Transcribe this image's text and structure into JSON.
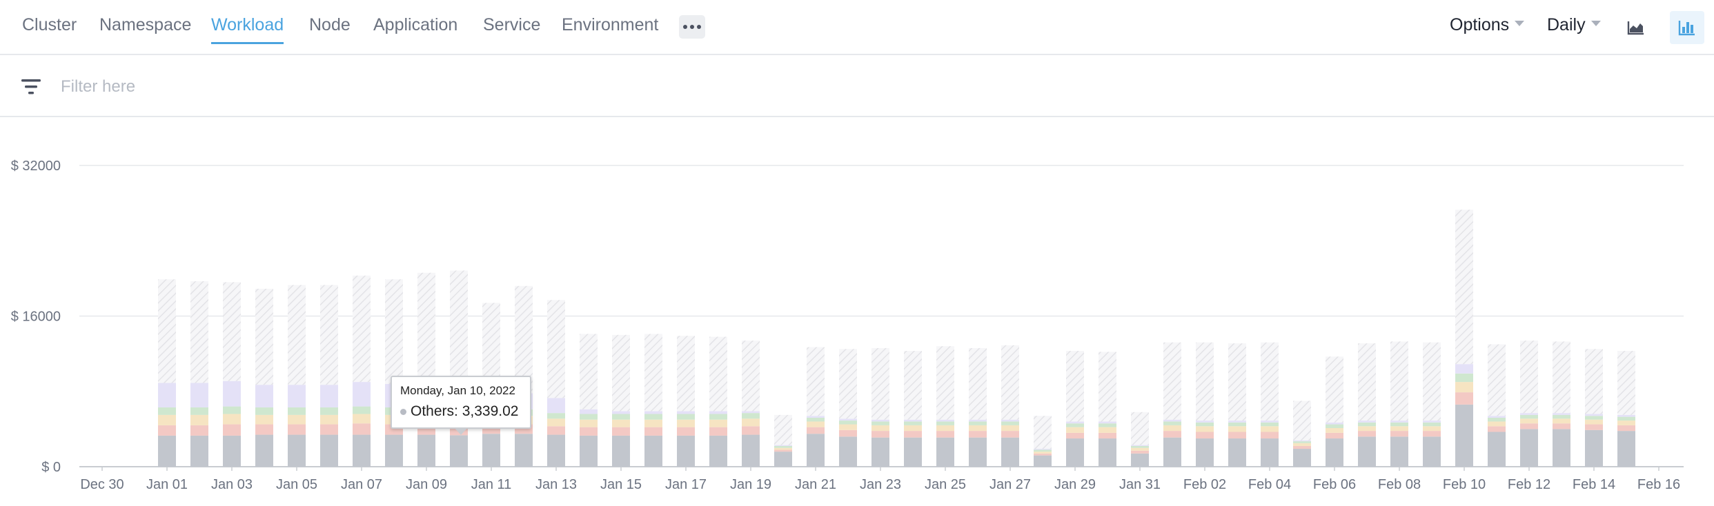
{
  "nav": {
    "tabs": [
      {
        "label": "Cluster"
      },
      {
        "label": "Namespace"
      },
      {
        "label": "Workload",
        "active": true
      },
      {
        "label": "Node"
      },
      {
        "label": "Application"
      },
      {
        "label": "Service"
      },
      {
        "label": "Environment"
      }
    ],
    "more_icon": "more-horizontal-icon",
    "options_label": "Options",
    "interval_label": "Daily",
    "area_chart_icon": "area-chart-icon",
    "bar_chart_icon": "bar-chart-icon"
  },
  "filter": {
    "icon": "filter-icon",
    "placeholder": "Filter here"
  },
  "colors": {
    "accent": "#4aa3df",
    "others_bar": "#c2c6cd",
    "hatch": "#ececef",
    "lavender": "#e4e1f7"
  },
  "tooltip": {
    "title": "Monday, Jan 10, 2022",
    "series": "Others:",
    "value": "3,339.02"
  },
  "chart_data": {
    "type": "bar",
    "stacked": true,
    "title": "",
    "xlabel": "",
    "ylabel": "",
    "ylim": [
      0,
      32000
    ],
    "y_ticks": [
      {
        "value": 0,
        "label": "$ 0"
      },
      {
        "value": 16000,
        "label": "$ 16000"
      },
      {
        "value": 32000,
        "label": "$ 32000"
      }
    ],
    "x_ticks": [
      "Dec 30",
      "Jan 01",
      "Jan 03",
      "Jan 05",
      "Jan 07",
      "Jan 09",
      "Jan 11",
      "Jan 13",
      "Jan 15",
      "Jan 17",
      "Jan 19",
      "Jan 21",
      "Jan 23",
      "Jan 25",
      "Jan 27",
      "Jan 29",
      "Jan 31",
      "Feb 02",
      "Feb 04",
      "Feb 06",
      "Feb 08",
      "Feb 10",
      "Feb 12",
      "Feb 14",
      "Feb 16"
    ],
    "grid": true,
    "categories": [
      "Jan 01",
      "Jan 02",
      "Jan 03",
      "Jan 04",
      "Jan 05",
      "Jan 06",
      "Jan 07",
      "Jan 08",
      "Jan 09",
      "Jan 10",
      "Jan 11",
      "Jan 12",
      "Jan 13",
      "Jan 14",
      "Jan 15",
      "Jan 16",
      "Jan 17",
      "Jan 18",
      "Jan 19",
      "Jan 20",
      "Jan 21",
      "Jan 22",
      "Jan 23",
      "Jan 24",
      "Jan 25",
      "Jan 26",
      "Jan 27",
      "Jan 28",
      "Jan 29",
      "Jan 30",
      "Jan 31",
      "Feb 01",
      "Feb 02",
      "Feb 03",
      "Feb 04",
      "Feb 05",
      "Feb 06",
      "Feb 07",
      "Feb 08",
      "Feb 09",
      "Feb 10",
      "Feb 11",
      "Feb 12",
      "Feb 13",
      "Feb 14",
      "Feb 15"
    ],
    "series": [
      {
        "name": "Others",
        "color": "#c2c6cd",
        "values": [
          3300,
          3300,
          3300,
          3400,
          3400,
          3400,
          3400,
          3400,
          3400,
          3339,
          3500,
          3500,
          3400,
          3300,
          3300,
          3300,
          3300,
          3300,
          3400,
          1600,
          3500,
          3200,
          3100,
          3100,
          3100,
          3100,
          3100,
          1200,
          3000,
          3000,
          1400,
          3100,
          3000,
          3000,
          3000,
          1900,
          3000,
          3200,
          3200,
          3200,
          6600,
          3700,
          4000,
          4000,
          3900,
          3800
        ]
      },
      {
        "name": "",
        "color": "#f3c9c4",
        "values": [
          1100,
          1100,
          1200,
          1100,
          1100,
          1100,
          1200,
          1100,
          1100,
          1100,
          1000,
          1000,
          900,
          900,
          900,
          900,
          900,
          900,
          900,
          200,
          700,
          700,
          700,
          700,
          700,
          700,
          700,
          200,
          600,
          600,
          300,
          700,
          700,
          700,
          700,
          300,
          600,
          600,
          600,
          600,
          1300,
          600,
          600,
          600,
          600,
          600
        ]
      },
      {
        "name": "",
        "color": "#f6e4c2",
        "values": [
          1100,
          1100,
          1100,
          1000,
          1000,
          1000,
          1000,
          1000,
          1000,
          1000,
          900,
          900,
          800,
          800,
          800,
          800,
          800,
          800,
          800,
          200,
          600,
          600,
          600,
          600,
          600,
          600,
          600,
          200,
          600,
          600,
          300,
          600,
          600,
          600,
          600,
          300,
          500,
          500,
          500,
          500,
          1100,
          500,
          500,
          500,
          500,
          500
        ]
      },
      {
        "name": "",
        "color": "#cfe7cf",
        "values": [
          800,
          800,
          800,
          800,
          800,
          800,
          800,
          800,
          800,
          800,
          700,
          700,
          600,
          600,
          600,
          600,
          600,
          600,
          600,
          200,
          400,
          400,
          400,
          400,
          400,
          400,
          400,
          200,
          400,
          400,
          200,
          400,
          400,
          400,
          400,
          200,
          400,
          400,
          400,
          400,
          900,
          400,
          400,
          400,
          400,
          400
        ]
      },
      {
        "name": "",
        "color": "#e4e1f7",
        "values": [
          2600,
          2600,
          2700,
          2400,
          2400,
          2400,
          2600,
          2500,
          2500,
          2400,
          1700,
          1700,
          1600,
          500,
          300,
          300,
          300,
          300,
          200,
          100,
          200,
          200,
          200,
          200,
          200,
          200,
          200,
          100,
          200,
          200,
          100,
          200,
          200,
          200,
          200,
          100,
          200,
          200,
          200,
          200,
          1000,
          200,
          200,
          200,
          200,
          200
        ]
      },
      {
        "name": "",
        "color": "#ececef",
        "hatched": true,
        "values": [
          11000,
          10800,
          10500,
          10200,
          10600,
          10600,
          11300,
          11100,
          11800,
          12200,
          9600,
          11400,
          10400,
          8000,
          8100,
          8200,
          8000,
          7900,
          7500,
          3200,
          7300,
          7400,
          7600,
          7300,
          7800,
          7600,
          7900,
          3500,
          7500,
          7400,
          3500,
          8200,
          8300,
          8200,
          8300,
          4200,
          7000,
          8200,
          8400,
          8300,
          16400,
          7600,
          7700,
          7600,
          6900,
          6800
        ]
      }
    ]
  }
}
